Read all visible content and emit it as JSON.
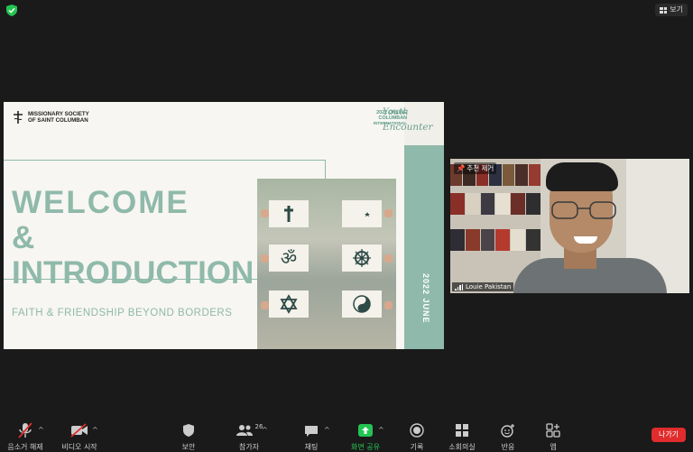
{
  "header": {
    "view_label": "보기"
  },
  "slide": {
    "org_name_line1": "MISSIONARY SOCIETY",
    "org_name_line2": "OF SAINT COLUMBAN",
    "event_line1": "2022 ONLINE",
    "event_line2": "COLUMBAN",
    "event_line3": "INTERNATIONAL",
    "script_word1": "Youth",
    "script_word2": "Encounter",
    "vertical_date": "2022 JUNE",
    "title_line1": "WELCOME",
    "title_line2": "&",
    "title_line3": "INTRODUCTION",
    "tagline": "FAITH & FRIENDSHIP BEYOND BORDERS",
    "symbol_icons": [
      "cross-icon",
      "crescent-star-icon",
      "om-icon",
      "dharma-wheel-icon",
      "star-of-david-icon",
      "yin-yang-icon"
    ]
  },
  "participant_video": {
    "pin_label": "추천 제거",
    "name": "Louie Pakistan"
  },
  "toolbar": {
    "mute_label": "음소거 해제",
    "video_label": "비디오 시작",
    "security_label": "보안",
    "participants_label": "참가자",
    "participants_count": "26",
    "chat_label": "채팅",
    "share_label": "화면 공유",
    "record_label": "기록",
    "breakout_label": "소회의실",
    "reactions_label": "반응",
    "apps_label": "앱",
    "leave_label": "나가기"
  },
  "colors": {
    "accent": "#8fb9ab",
    "share_green": "#23c552",
    "leave_red": "#e02c2c"
  }
}
